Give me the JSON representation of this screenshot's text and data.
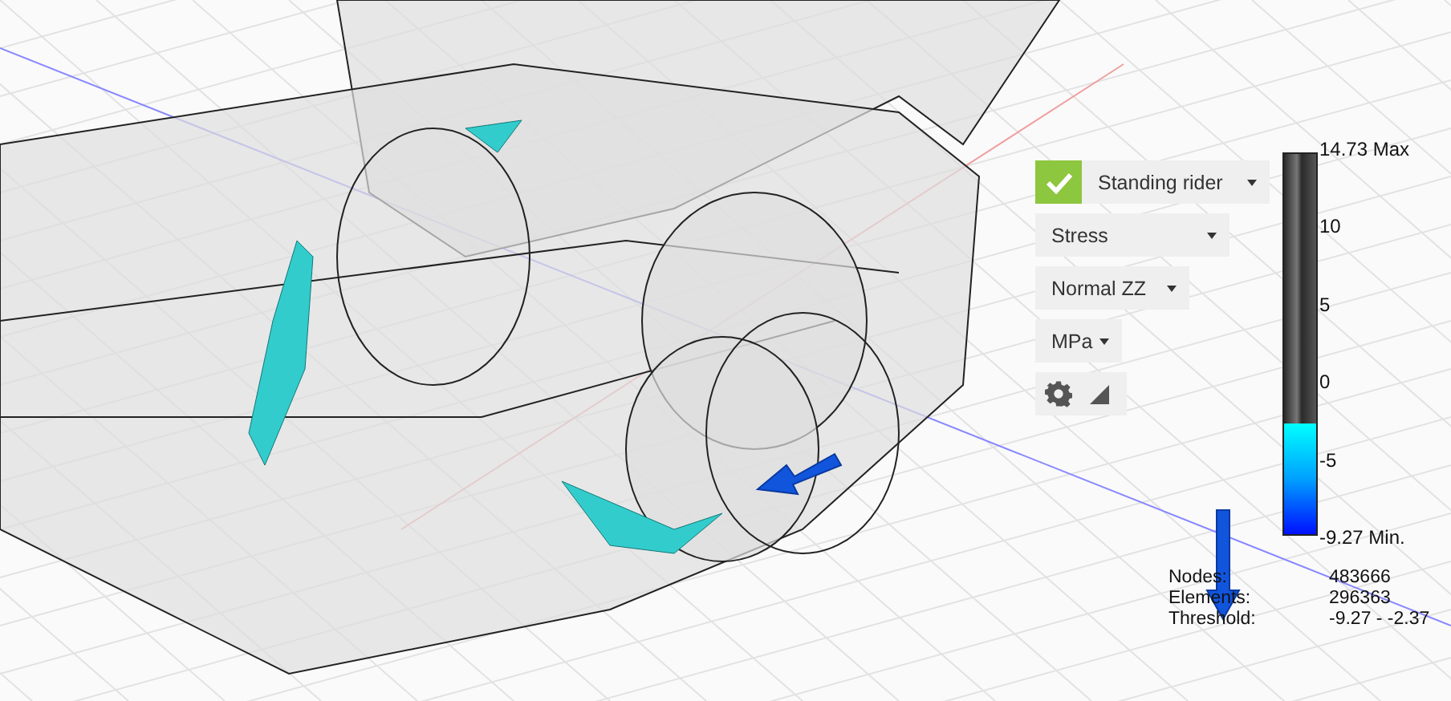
{
  "study": {
    "load_case": "Standing rider",
    "checked": true,
    "result_type": "Stress",
    "component": "Normal ZZ",
    "unit": "MPa"
  },
  "legend": {
    "labels": [
      "14.73 Max",
      "10",
      "5",
      "0",
      "-5",
      "-9.27 Min."
    ],
    "level": 0.29
  },
  "stats": [
    {
      "label": "Nodes:",
      "value": "483666"
    },
    {
      "label": "Elements:",
      "value": "296363"
    },
    {
      "label": "Threshold:",
      "value": "-9.27 - -2.37"
    }
  ]
}
